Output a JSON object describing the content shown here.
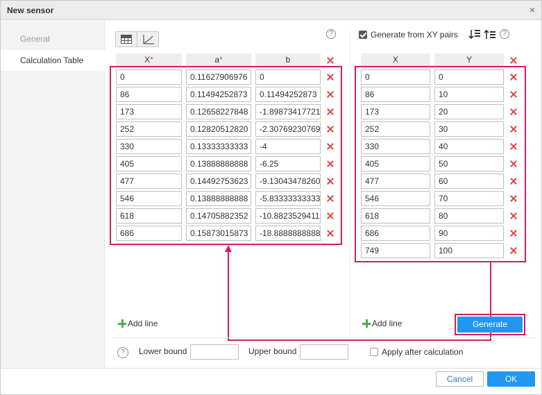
{
  "window": {
    "title": "New sensor",
    "close_glyph": "×"
  },
  "sidebar": {
    "items": [
      {
        "label": "General",
        "active": false
      },
      {
        "label": "Calculation Table",
        "active": true
      }
    ]
  },
  "left_table": {
    "headers": {
      "x": "X",
      "a": "a",
      "b": "b",
      "required_mark": "*"
    },
    "rows": [
      {
        "x": "0",
        "a": "0.11627906976",
        "b": "0"
      },
      {
        "x": "86",
        "a": "0.11494252873",
        "b": "0.11494252873"
      },
      {
        "x": "173",
        "a": "0.12658227848",
        "b": "-1.89873417721"
      },
      {
        "x": "252",
        "a": "0.12820512820",
        "b": "-2.30769230769"
      },
      {
        "x": "330",
        "a": "0.13333333333",
        "b": "-4"
      },
      {
        "x": "405",
        "a": "0.13888888888",
        "b": "-6.25"
      },
      {
        "x": "477",
        "a": "0.14492753623",
        "b": "-9.13043478260"
      },
      {
        "x": "546",
        "a": "0.13888888888",
        "b": "-5.83333333333"
      },
      {
        "x": "618",
        "a": "0.14705882352",
        "b": "-10.8823529411"
      },
      {
        "x": "686",
        "a": "0.15873015873",
        "b": "-18.8888888888"
      }
    ],
    "add_line_label": "Add line"
  },
  "right_table": {
    "generate_checkbox_label": "Generate from XY pairs",
    "generate_checked": true,
    "headers": {
      "x": "X",
      "y": "Y"
    },
    "rows": [
      {
        "x": "0",
        "y": "0"
      },
      {
        "x": "86",
        "y": "10"
      },
      {
        "x": "173",
        "y": "20"
      },
      {
        "x": "252",
        "y": "30"
      },
      {
        "x": "330",
        "y": "40"
      },
      {
        "x": "405",
        "y": "50"
      },
      {
        "x": "477",
        "y": "60"
      },
      {
        "x": "546",
        "y": "70"
      },
      {
        "x": "618",
        "y": "80"
      },
      {
        "x": "686",
        "y": "90"
      },
      {
        "x": "749",
        "y": "100"
      }
    ],
    "add_line_label": "Add line",
    "generate_button_label": "Generate"
  },
  "bounds": {
    "help_glyph": "?",
    "lower_label": "Lower bound",
    "upper_label": "Upper bound",
    "lower_value": "",
    "upper_value": "",
    "apply_after_label": "Apply after calculation",
    "apply_after_checked": false
  },
  "footer": {
    "cancel_label": "Cancel",
    "ok_label": "OK"
  },
  "colors": {
    "accent": "#2196f3",
    "highlight": "#d81b60",
    "delete": "#e04848",
    "add": "#4caf50"
  }
}
